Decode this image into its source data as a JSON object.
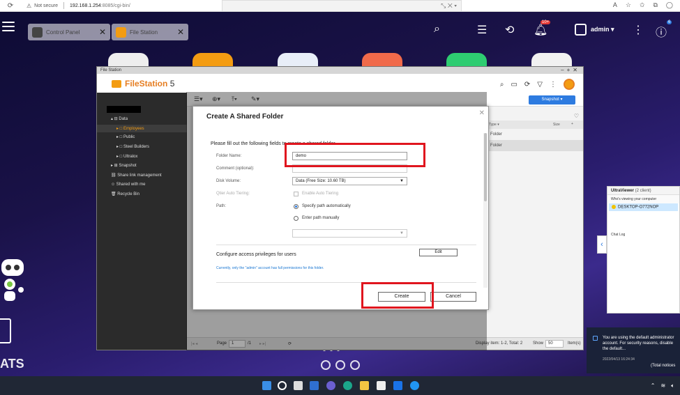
{
  "browser": {
    "security": "Not secure",
    "url_host": "192.168.1.254",
    "url_rest": ":8085/cgi-bin/"
  },
  "tabs": [
    {
      "label": "Control Panel"
    },
    {
      "label": "File Station"
    }
  ],
  "topbar": {
    "notification_count": "10+",
    "info_count": "6",
    "user": "admin ▾"
  },
  "filestation": {
    "window_title": "File Station",
    "app_name": "FileStation",
    "app_version": "5",
    "snapshot_label": "Snapshot ▾",
    "sidebar": [
      {
        "label": "Data"
      },
      {
        "label": "Employees"
      },
      {
        "label": "Public"
      },
      {
        "label": "Steel Builders"
      },
      {
        "label": "Ultralox"
      },
      {
        "label": "Snapshot"
      },
      {
        "label": "Share link management"
      },
      {
        "label": "Shared with me"
      },
      {
        "label": "Recycle Bin"
      }
    ],
    "columns": {
      "type": "Type ▾",
      "size": "Size"
    },
    "rows": [
      {
        "type": "Folder"
      },
      {
        "type": "Folder"
      }
    ],
    "status": {
      "page_label": "Page",
      "page_value": "1",
      "page_total": "/1",
      "display": "Display item: 1-2, Total: 2",
      "show_label": "Show",
      "show_value": "50",
      "items_label": "Item(s)"
    }
  },
  "dialog": {
    "title": "Create A Shared Folder",
    "intro": "Please fill out the following fields to create a shared folder.",
    "folder_name_label": "Folder Name:",
    "folder_name_value": "demo",
    "comment_label": "Comment (optional):",
    "disk_volume_label": "Disk Volume:",
    "disk_volume_value": "Data (Free Size: 10.60 TB)",
    "tiering_label": "Qtier Auto Tiering:",
    "tiering_option": "Enable Auto Tiering",
    "path_label": "Path:",
    "path_auto": "Specify path automatically",
    "path_manual": "Enter path manually",
    "privileges_label": "Configure access privileges for users",
    "edit_button": "Edit",
    "note": "Currently, only the \"admin\" account has full permissions for this folder.",
    "create_button": "Create",
    "cancel_button": "Cancel"
  },
  "ultraviewer": {
    "title": "UltraViewer",
    "clients": "(2 client)",
    "viewing": "Who's viewing your computer",
    "computer": "DESKTOP-O772NOP",
    "chat_log": "Chat Log"
  },
  "notification": {
    "text": "You are using the default administrator account. For security reasons, disable the default...",
    "time": "2022/04/13 16:24:34",
    "total": "(Total notices"
  },
  "desktop": {
    "qts": "ATS"
  },
  "colors": {
    "accent": "#2d7be0",
    "brand": "#f39c12",
    "highlight": "#e0151e"
  }
}
